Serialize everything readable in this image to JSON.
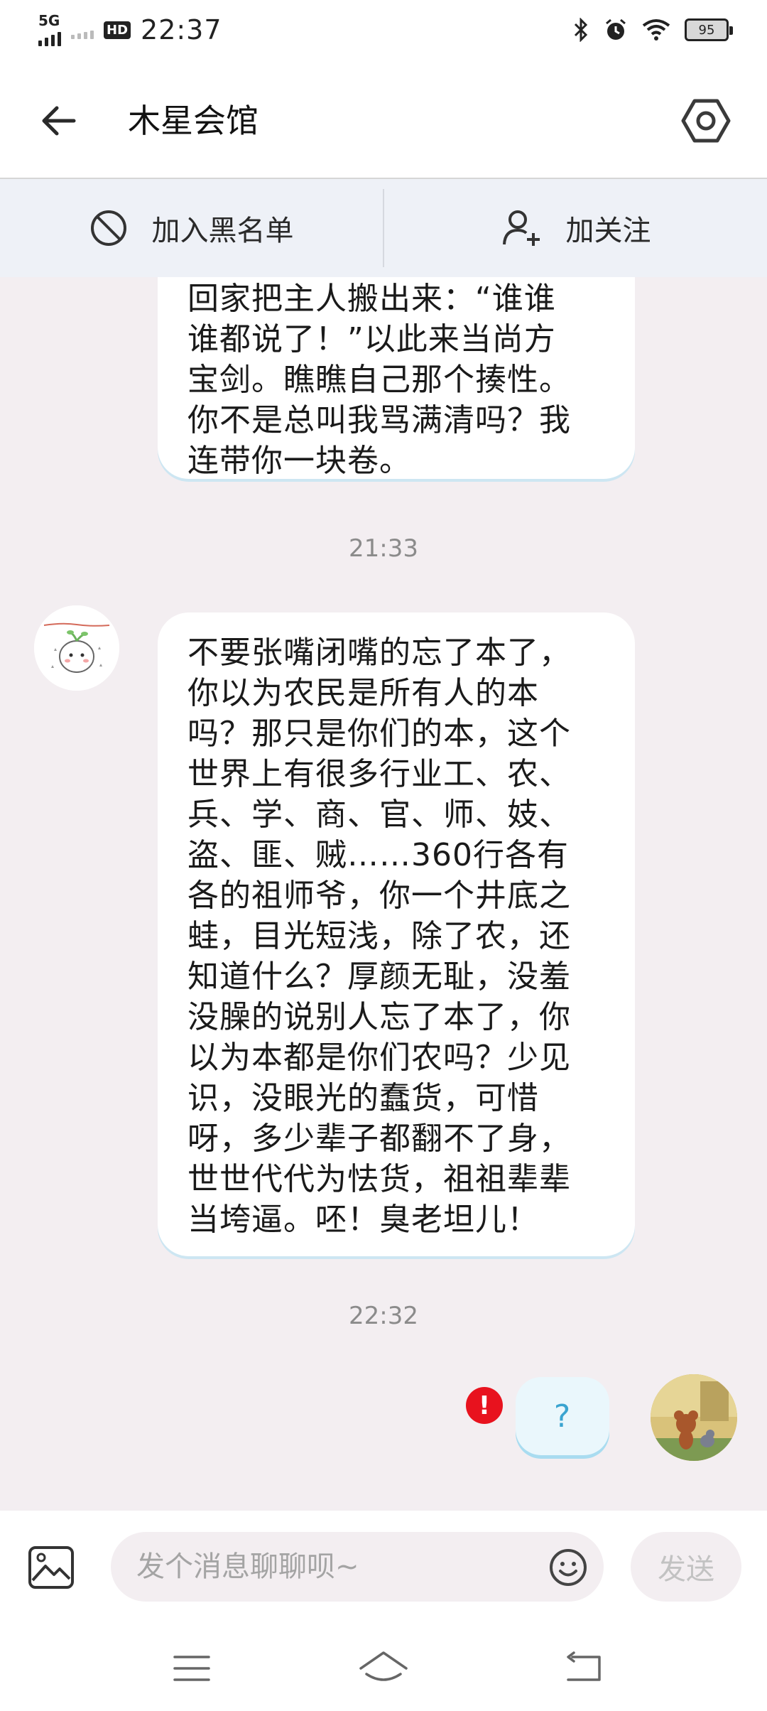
{
  "status_bar": {
    "network": "5G",
    "hd": "HD",
    "time": "22:37",
    "battery": "95"
  },
  "header": {
    "title": "木星会馆"
  },
  "actions": {
    "blacklist_label": "加入黑名单",
    "follow_label": "加关注"
  },
  "messages": [
    {
      "side": "left",
      "text": "回家把主人搬出来：“谁谁\n谁都说了！”以此来当尚方\n宝剑。瞧瞧自己那个揍性。\n你不是总叫我骂满清吗？我\n连带你一块卷。"
    },
    {
      "type": "timestamp",
      "text": "21:33"
    },
    {
      "side": "left",
      "text": "不要张嘴闭嘴的忘了本了，\n你以为农民是所有人的本\n吗？那只是你们的本，这个\n世界上有很多行业工、农、\n兵、学、商、官、师、妓、\n盗、匪、贼……360行各有\n各的祖师爷，你一个井底之\n蛙，目光短浅，除了农，还\n知道什么？厚颜无耻，没羞\n没臊的说别人忘了本了，你\n以为本都是你们农吗？少见\n识，没眼光的蠢货，可惜\n呀，多少辈子都翻不了身，\n世世代代为怯货，祖祖辈辈\n当垮逼。呸！臭老坦儿！"
    },
    {
      "type": "timestamp",
      "text": "22:32"
    },
    {
      "side": "right",
      "text": "?",
      "error_mark": "!"
    }
  ],
  "input": {
    "placeholder": "发个消息聊聊呗~",
    "value": "",
    "send_label": "发送"
  },
  "colors": {
    "chat_background": "#f3eef1",
    "bubble_shadow": "#cde6f2",
    "error_red": "#e8121e",
    "question_blue": "#3aa4d0"
  },
  "icons": {
    "header": [
      "back-arrow-icon",
      "settings-hexagon-icon"
    ],
    "actions": [
      "block-icon",
      "add-user-icon"
    ],
    "input": [
      "image-icon",
      "emoji-icon"
    ],
    "nav": [
      "menu-icon",
      "home-icon",
      "back-icon"
    ]
  }
}
